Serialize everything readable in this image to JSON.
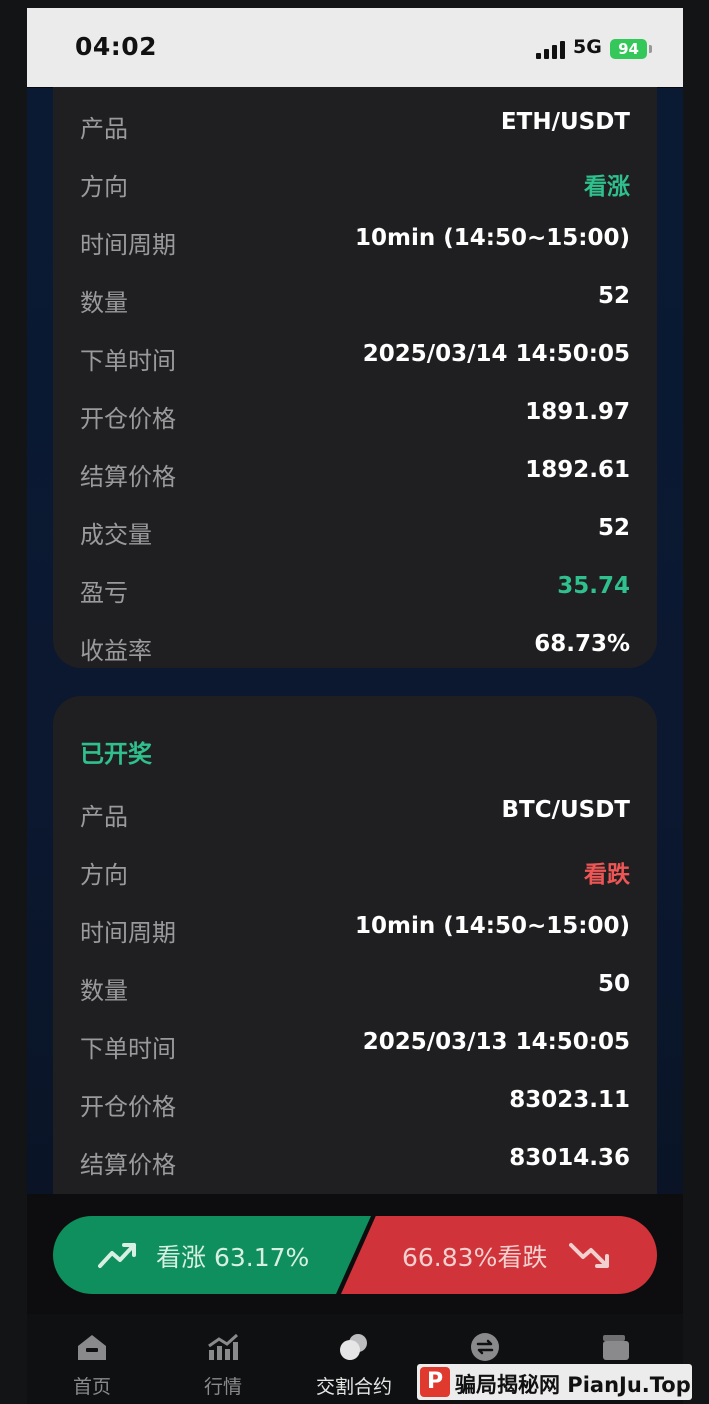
{
  "status_bar": {
    "time": "04:02",
    "network": "5G",
    "battery": "94"
  },
  "orders": [
    {
      "rows": [
        {
          "label": "产品",
          "value": "ETH/USDT"
        },
        {
          "label": "方向",
          "value": "看涨"
        },
        {
          "label": "时间周期",
          "value": "10min (14:50~15:00)"
        },
        {
          "label": "数量",
          "value": "52"
        },
        {
          "label": "下单时间",
          "value": "2025/03/14 14:50:05"
        },
        {
          "label": "开仓价格",
          "value": "1891.97"
        },
        {
          "label": "结算价格",
          "value": "1892.61"
        },
        {
          "label": "成交量",
          "value": "52"
        },
        {
          "label": "盈亏",
          "value": "35.74"
        },
        {
          "label": "收益率",
          "value": "68.73%"
        }
      ]
    },
    {
      "status": "已开奖",
      "rows": [
        {
          "label": "产品",
          "value": "BTC/USDT"
        },
        {
          "label": "方向",
          "value": "看跌"
        },
        {
          "label": "时间周期",
          "value": "10min (14:50~15:00)"
        },
        {
          "label": "数量",
          "value": "50"
        },
        {
          "label": "下单时间",
          "value": "2025/03/13 14:50:05"
        },
        {
          "label": "开仓价格",
          "value": "83023.11"
        },
        {
          "label": "结算价格",
          "value": "83014.36"
        }
      ]
    }
  ],
  "trade": {
    "up_label": "看涨",
    "up_percent": "63.17%",
    "down_text": "66.83%看跌"
  },
  "tabs": [
    {
      "label": "首页",
      "icon": "home-icon"
    },
    {
      "label": "行情",
      "icon": "chart-icon"
    },
    {
      "label": "交割合约",
      "icon": "coins-icon"
    },
    {
      "label": "",
      "icon": "exchange-icon"
    },
    {
      "label": "",
      "icon": "wallet-icon"
    }
  ],
  "watermark": {
    "text": "骗局揭秘网 PianJu.Top",
    "logo": "P"
  },
  "colors": {
    "rise": "#2fc08d",
    "fall": "#ee5656",
    "card": "#1f1f21"
  }
}
